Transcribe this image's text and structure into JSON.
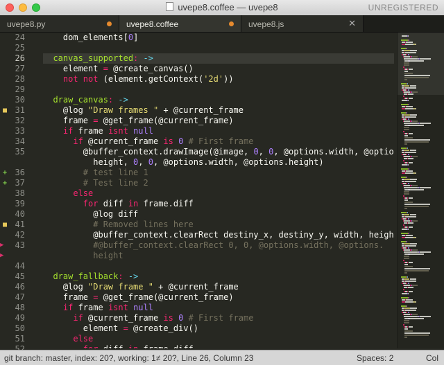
{
  "window": {
    "title": "uvepe8.coffee — uvepe8",
    "registration": "UNREGISTERED"
  },
  "tabs": [
    {
      "label": "uvepe8.py",
      "state": "dirty"
    },
    {
      "label": "uvepe8.coffee",
      "state": "dirty-active"
    },
    {
      "label": "uvepe8.js",
      "state": "close"
    }
  ],
  "editor": {
    "current_line": "26",
    "gutter": [
      {
        "n": "24",
        "mark": ""
      },
      {
        "n": "25",
        "mark": ""
      },
      {
        "n": "26",
        "mark": ""
      },
      {
        "n": "27",
        "mark": ""
      },
      {
        "n": "28",
        "mark": ""
      },
      {
        "n": "29",
        "mark": ""
      },
      {
        "n": "30",
        "mark": ""
      },
      {
        "n": "31",
        "mark": "modified"
      },
      {
        "n": "32",
        "mark": ""
      },
      {
        "n": "33",
        "mark": ""
      },
      {
        "n": "34",
        "mark": ""
      },
      {
        "n": "35",
        "mark": ""
      },
      {
        "n": "",
        "mark": ""
      },
      {
        "n": "36",
        "mark": "added"
      },
      {
        "n": "37",
        "mark": "added"
      },
      {
        "n": "38",
        "mark": ""
      },
      {
        "n": "39",
        "mark": ""
      },
      {
        "n": "40",
        "mark": ""
      },
      {
        "n": "41",
        "mark": "modified"
      },
      {
        "n": "42",
        "mark": ""
      },
      {
        "n": "43",
        "mark": "deleted"
      },
      {
        "n": "",
        "mark": "deleted"
      },
      {
        "n": "44",
        "mark": ""
      },
      {
        "n": "45",
        "mark": ""
      },
      {
        "n": "46",
        "mark": ""
      },
      {
        "n": "47",
        "mark": ""
      },
      {
        "n": "48",
        "mark": ""
      },
      {
        "n": "49",
        "mark": ""
      },
      {
        "n": "50",
        "mark": ""
      },
      {
        "n": "51",
        "mark": ""
      },
      {
        "n": "52",
        "mark": ""
      }
    ],
    "lines": [
      [
        [
          "    dom_elements[",
          "p"
        ],
        [
          "0",
          "n"
        ],
        [
          "]",
          "p"
        ]
      ],
      [],
      [
        [
          "  canvas_supported",
          "f"
        ],
        [
          ": ",
          "k"
        ],
        [
          "->",
          "a"
        ]
      ],
      [
        [
          "    element ",
          "p"
        ],
        [
          "=",
          "k"
        ],
        [
          " @create_canvas()",
          "p"
        ]
      ],
      [
        [
          "    ",
          "p"
        ],
        [
          "not not",
          "k"
        ],
        [
          " (element.getContext(",
          "p"
        ],
        [
          "'2d'",
          "s"
        ],
        [
          "))",
          "p"
        ]
      ],
      [],
      [
        [
          "  draw_canvas",
          "f"
        ],
        [
          ": ",
          "k"
        ],
        [
          "->",
          "a"
        ]
      ],
      [
        [
          "    @log ",
          "p"
        ],
        [
          "\"Draw frames \"",
          "s"
        ],
        [
          " + @current_frame",
          "p"
        ]
      ],
      [
        [
          "    frame ",
          "p"
        ],
        [
          "=",
          "k"
        ],
        [
          " @get_frame(@current_frame)",
          "p"
        ]
      ],
      [
        [
          "    ",
          "p"
        ],
        [
          "if",
          "k"
        ],
        [
          " frame ",
          "p"
        ],
        [
          "isnt",
          "k"
        ],
        [
          " ",
          "p"
        ],
        [
          "null",
          "n"
        ]
      ],
      [
        [
          "      ",
          "p"
        ],
        [
          "if",
          "k"
        ],
        [
          " @current_frame ",
          "p"
        ],
        [
          "is",
          "k"
        ],
        [
          " ",
          "p"
        ],
        [
          "0",
          "n"
        ],
        [
          " ",
          "p"
        ],
        [
          "# First frame",
          "c"
        ]
      ],
      [
        [
          "        @buffer_context.drawImage(@image, ",
          "p"
        ],
        [
          "0",
          "n"
        ],
        [
          ", ",
          "p"
        ],
        [
          "0",
          "n"
        ],
        [
          ", @options.width, @options.",
          "p"
        ]
      ],
      [
        [
          "          height, ",
          "p"
        ],
        [
          "0",
          "n"
        ],
        [
          ", ",
          "p"
        ],
        [
          "0",
          "n"
        ],
        [
          ", @options.width, @options.height)",
          "p"
        ]
      ],
      [
        [
          "        ",
          "p"
        ],
        [
          "# test line 1",
          "c"
        ]
      ],
      [
        [
          "        ",
          "p"
        ],
        [
          "# Test line 2",
          "c"
        ]
      ],
      [
        [
          "      ",
          "p"
        ],
        [
          "else",
          "k"
        ]
      ],
      [
        [
          "        ",
          "p"
        ],
        [
          "for",
          "k"
        ],
        [
          " diff ",
          "p"
        ],
        [
          "in",
          "k"
        ],
        [
          " frame.diff",
          "p"
        ]
      ],
      [
        [
          "          @log diff",
          "p"
        ]
      ],
      [
        [
          "          ",
          "p"
        ],
        [
          "# Removed lines here",
          "c"
        ]
      ],
      [
        [
          "          @buffer_context.clearRect destiny_x, destiny_y, width, height",
          "p"
        ]
      ],
      [
        [
          "          ",
          "p"
        ],
        [
          "#@buffer_context.clearRect 0, 0, @options.width, @options.",
          "c"
        ]
      ],
      [
        [
          "          ",
          "p"
        ],
        [
          "height",
          "c"
        ]
      ],
      [],
      [
        [
          "  draw_fallback",
          "f"
        ],
        [
          ": ",
          "k"
        ],
        [
          "->",
          "a"
        ]
      ],
      [
        [
          "    @log ",
          "p"
        ],
        [
          "\"Draw frame \"",
          "s"
        ],
        [
          " + @current_frame",
          "p"
        ]
      ],
      [
        [
          "    frame ",
          "p"
        ],
        [
          "=",
          "k"
        ],
        [
          " @get_frame(@current_frame)",
          "p"
        ]
      ],
      [
        [
          "    ",
          "p"
        ],
        [
          "if",
          "k"
        ],
        [
          " frame ",
          "p"
        ],
        [
          "isnt",
          "k"
        ],
        [
          " ",
          "p"
        ],
        [
          "null",
          "n"
        ]
      ],
      [
        [
          "      ",
          "p"
        ],
        [
          "if",
          "k"
        ],
        [
          " @current_frame ",
          "p"
        ],
        [
          "is",
          "k"
        ],
        [
          " ",
          "p"
        ],
        [
          "0",
          "n"
        ],
        [
          " ",
          "p"
        ],
        [
          "# First frame",
          "c"
        ]
      ],
      [
        [
          "        element ",
          "p"
        ],
        [
          "=",
          "k"
        ],
        [
          " @create_div()",
          "p"
        ]
      ],
      [
        [
          "      ",
          "p"
        ],
        [
          "else",
          "k"
        ]
      ],
      [
        [
          "        ",
          "p"
        ],
        [
          "for",
          "k"
        ],
        [
          " diff ",
          "p"
        ],
        [
          "in",
          "k"
        ],
        [
          " frame.diff",
          "p"
        ]
      ]
    ]
  },
  "syntax_colors": {
    "p": "#f8f8f2",
    "k": "#f92672",
    "f": "#a6e22e",
    "a": "#66d9ef",
    "s": "#e6db74",
    "n": "#ae81ff",
    "c": "#75715e"
  },
  "status": {
    "left": "git branch: master, index: 20?, working: 1≠ 20?, Line 26, Column 23",
    "spaces": "Spaces: 2",
    "syntax": "Col"
  }
}
